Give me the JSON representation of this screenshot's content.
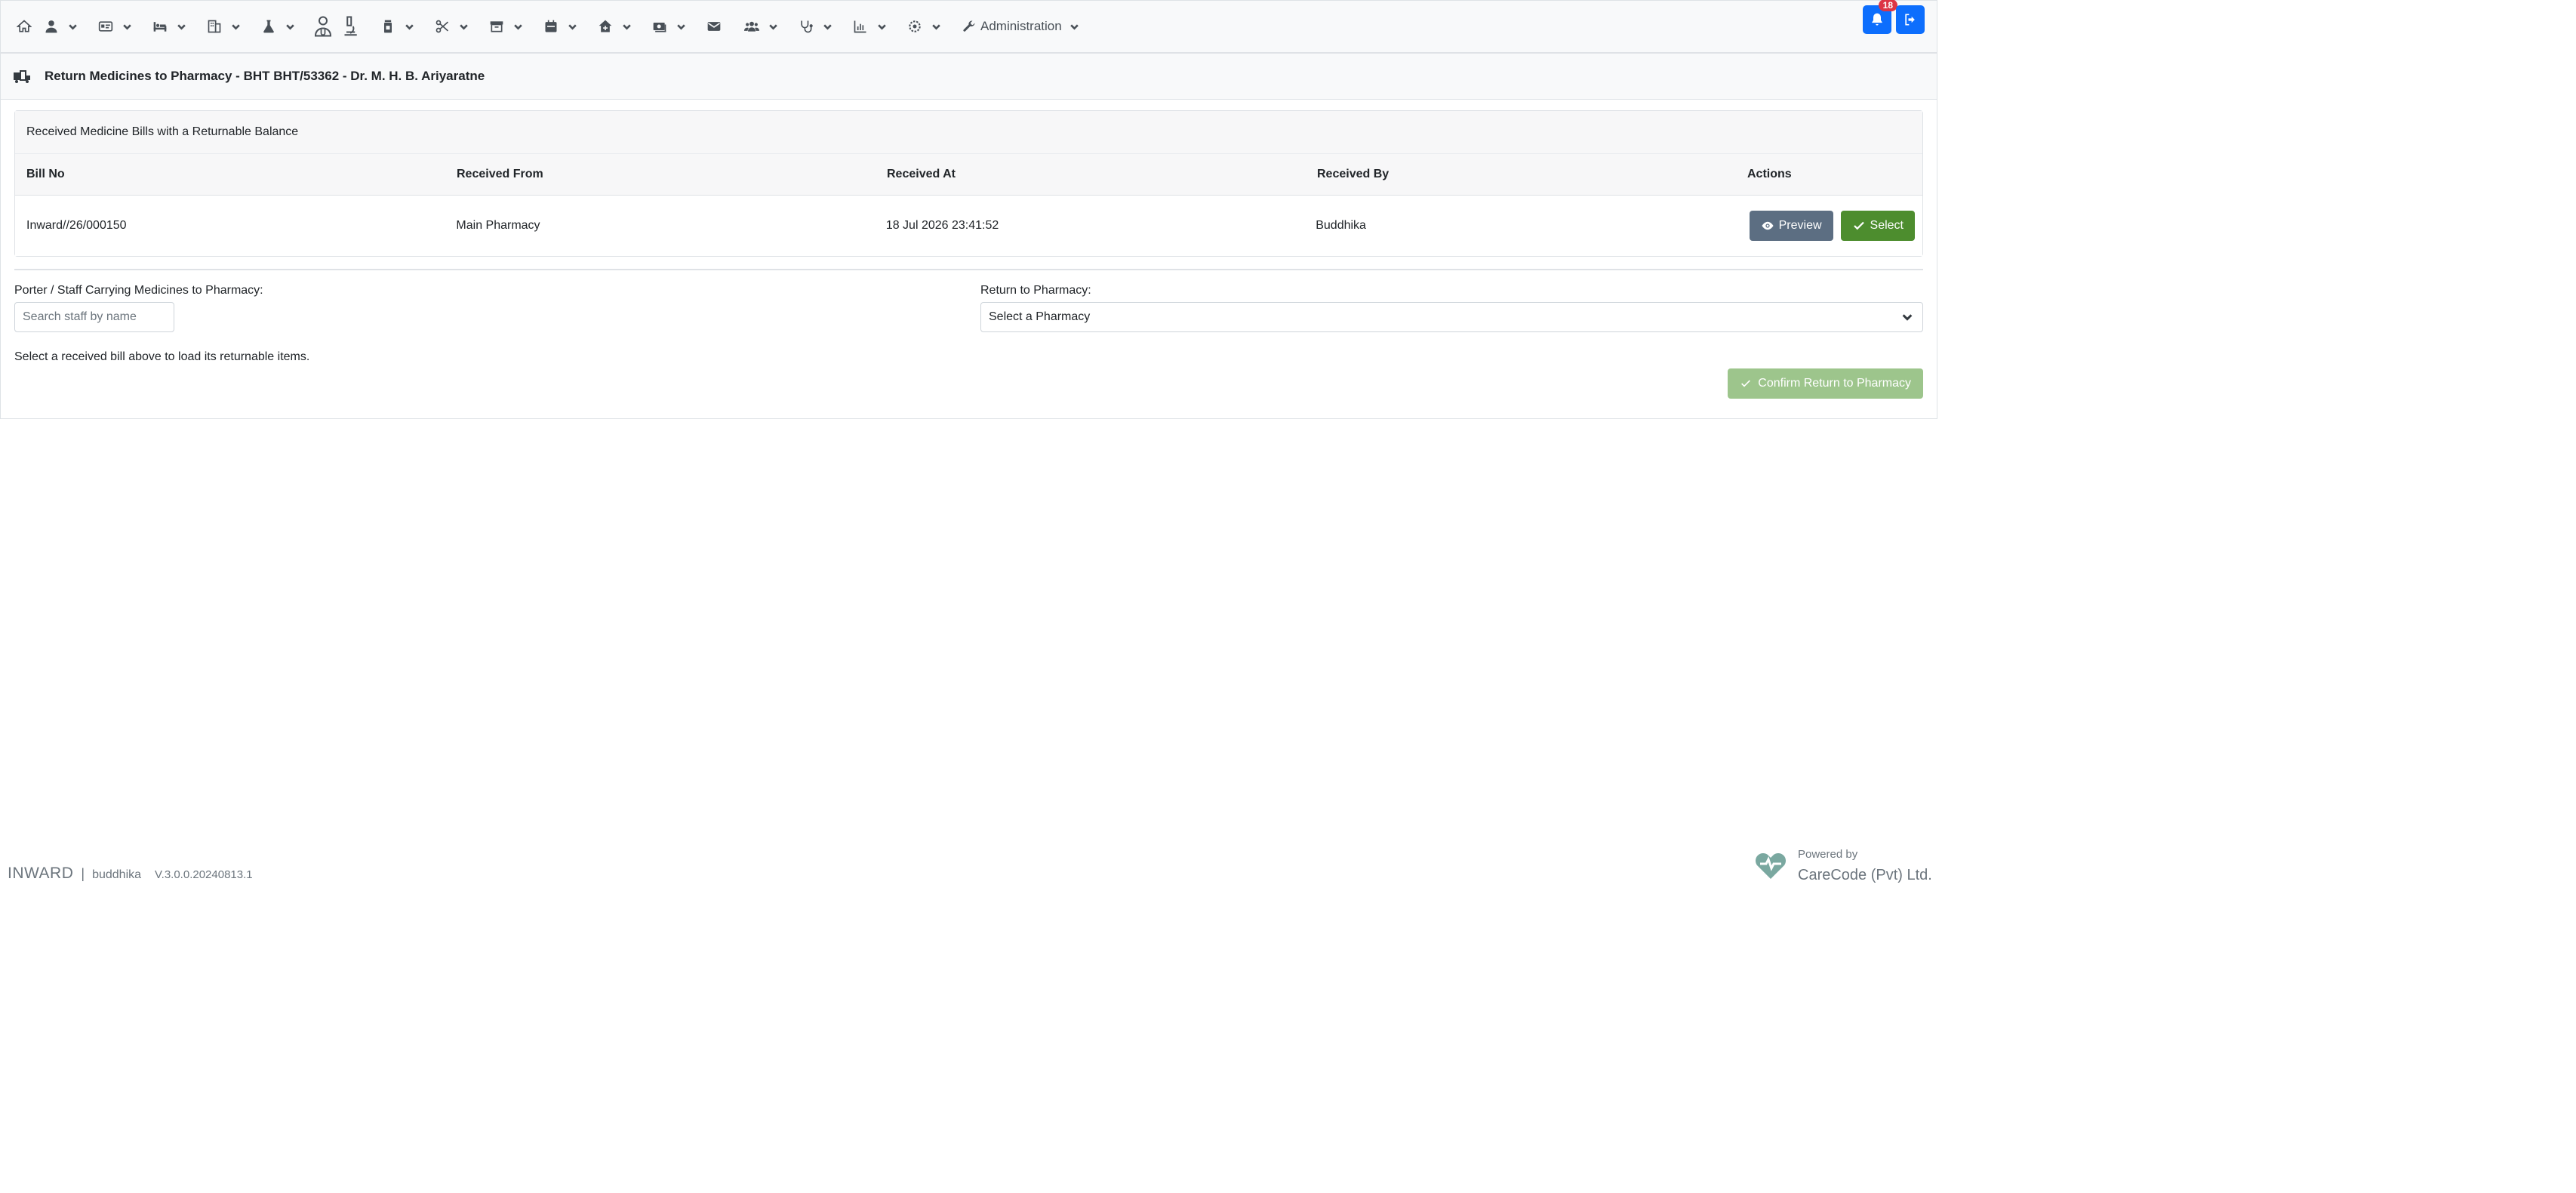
{
  "navbar": {
    "menus": [
      {
        "icon": "home-icon",
        "dropdown": false
      },
      {
        "icon": "user-icon",
        "dropdown": true
      },
      {
        "icon": "id-card-icon",
        "dropdown": true
      },
      {
        "icon": "bed-icon",
        "dropdown": true
      },
      {
        "icon": "building-icon",
        "dropdown": true
      },
      {
        "icon": "flask-icon",
        "dropdown": true
      },
      {
        "icon": "doctor-icon",
        "dropdown": false
      },
      {
        "icon": "microscope-icon",
        "dropdown": false
      },
      {
        "icon": "medicine-bottle-icon",
        "dropdown": true
      },
      {
        "icon": "scissors-icon",
        "dropdown": true
      },
      {
        "icon": "store-icon",
        "dropdown": true
      },
      {
        "icon": "calendar-icon",
        "dropdown": true
      },
      {
        "icon": "clinic-icon",
        "dropdown": true
      },
      {
        "icon": "money-icon",
        "dropdown": true
      },
      {
        "icon": "envelope-icon",
        "dropdown": false
      },
      {
        "icon": "users-icon",
        "dropdown": true
      },
      {
        "icon": "stethoscope-icon",
        "dropdown": true
      },
      {
        "icon": "chart-icon",
        "dropdown": true
      },
      {
        "icon": "settings-icon",
        "dropdown": true
      }
    ],
    "admin_label": "Administration",
    "notification_count": "18"
  },
  "page": {
    "title": "Return Medicines to Pharmacy - BHT BHT/53362 - Dr. M. H. B. Ariyaratne"
  },
  "bills_card": {
    "heading": "Received Medicine Bills with a Returnable Balance",
    "columns": [
      "Bill No",
      "Received From",
      "Received At",
      "Received By",
      "Actions"
    ],
    "rows": [
      {
        "bill_no": "Inward//26/000150",
        "received_from": "Main Pharmacy",
        "received_at": "18 Jul 2026 23:41:52",
        "received_by": "Buddhika"
      }
    ],
    "preview_label": "Preview",
    "select_label": "Select"
  },
  "form": {
    "porter_label": "Porter / Staff Carrying Medicines to Pharmacy:",
    "porter_placeholder": "Search staff by name",
    "pharmacy_label": "Return to Pharmacy:",
    "pharmacy_value": "Select a Pharmacy",
    "hint": "Select a received bill above to load its returnable items.",
    "confirm_label": "Confirm Return to Pharmacy"
  },
  "footer": {
    "module": "INWARD",
    "separator": "|",
    "user": "buddhika",
    "version": "V.3.0.0.20240813.1",
    "powered_by": "Powered by",
    "company": "CareCode (Pvt) Ltd."
  },
  "colors": {
    "primary": "#0d6efd",
    "preview_button": "#5c6e82",
    "select_button": "#4d8d2e",
    "confirm_button_disabled": "#9dc58c",
    "badge": "#dc3545"
  }
}
